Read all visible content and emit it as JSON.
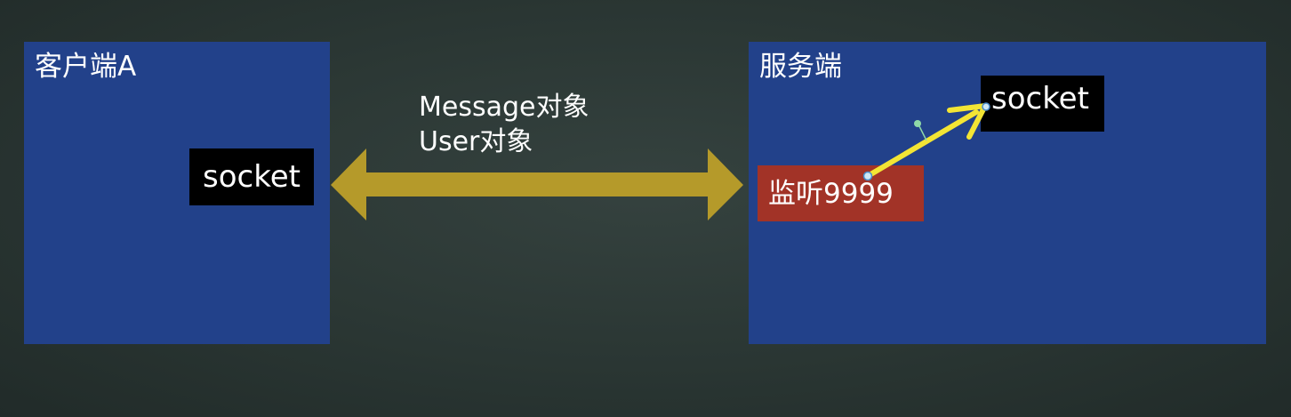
{
  "client": {
    "title": "客户端A",
    "socket_label": "socket"
  },
  "server": {
    "title": "服务端",
    "socket_label": "socket",
    "listen_label": "监听9999"
  },
  "connection": {
    "messages": [
      "Message对象",
      "User对象"
    ]
  },
  "colors": {
    "background": "#2a3633",
    "panel": "#22418a",
    "socket_box": "#000000",
    "listen_box": "#a23327",
    "double_arrow": "#b59a2a",
    "accept_arrow": "#f3e534"
  }
}
